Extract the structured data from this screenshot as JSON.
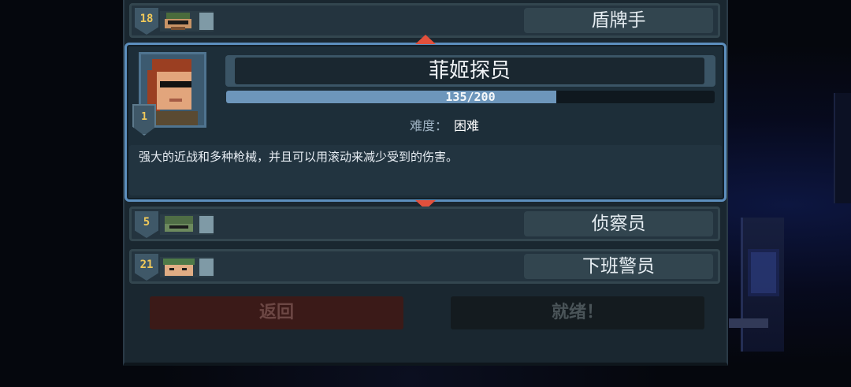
{
  "roster": [
    {
      "level": "18",
      "name": "盾牌手"
    },
    {
      "level": "5",
      "name": "侦察员"
    },
    {
      "level": "21",
      "name": "下班警员"
    }
  ],
  "selected": {
    "level": "1",
    "name": "菲姬探员",
    "xp_text": "135/200",
    "xp_progress": 0.675,
    "difficulty_label": "难度：",
    "difficulty_value": "困难",
    "description": "强大的近战和多种枪械，并且可以用滚动来减少受到的伤害。"
  },
  "buttons": {
    "back": "返回",
    "ready": "就绪！"
  },
  "colors": {
    "accent_border": "#5d8fbe",
    "arrow": "#e2503c",
    "xp_fill": "#6d96bb",
    "level_text": "#f0c95a"
  },
  "icons": {
    "scroll_up": "triangle-up-icon",
    "scroll_down": "triangle-down-icon"
  }
}
